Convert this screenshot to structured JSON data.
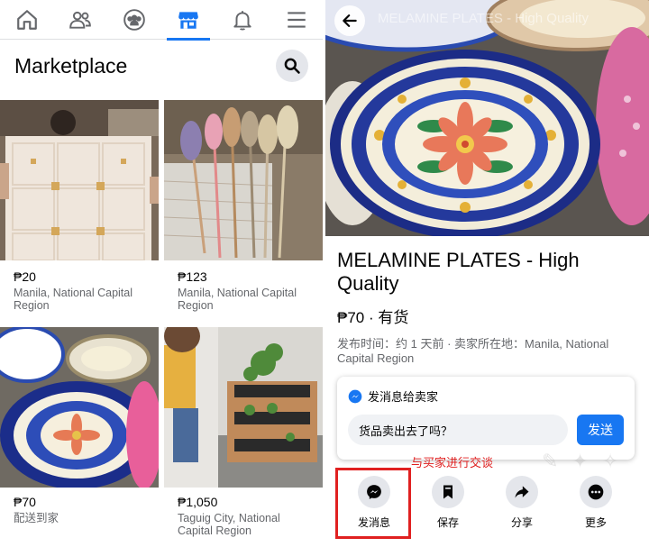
{
  "left": {
    "nav": [
      {
        "name": "home-icon"
      },
      {
        "name": "friends-icon"
      },
      {
        "name": "groups-icon"
      },
      {
        "name": "marketplace-icon",
        "active": true
      },
      {
        "name": "bell-icon"
      },
      {
        "name": "menu-icon"
      }
    ],
    "title": "Marketplace",
    "listings": [
      {
        "price": "₱20",
        "location": "Manila, National Capital Region"
      },
      {
        "price": "₱123",
        "location": "Manila, National Capital Region"
      },
      {
        "price": "₱70",
        "location": "配送到家"
      },
      {
        "price": "₱1,050",
        "location": "Taguig City, National Capital Region"
      }
    ]
  },
  "right": {
    "hero_title": "MELAMINE PLATES - High Quality",
    "title": "MELAMINE PLATES - High Quality",
    "price_status": "₱70 · 有货",
    "meta": "发布时间：约 1 天前 · 卖家所在地：Manila, National Capital Region",
    "message_card": {
      "header": "发消息给卖家",
      "input_value": "货品卖出去了吗？",
      "send_label": "发送"
    },
    "annotation": "与买家进行交谈",
    "actions": [
      {
        "label": "发消息",
        "icon": "messenger-icon"
      },
      {
        "label": "保存",
        "icon": "bookmark-icon"
      },
      {
        "label": "分享",
        "icon": "share-icon"
      },
      {
        "label": "更多",
        "icon": "more-icon"
      }
    ]
  },
  "colors": {
    "accent": "#1877f2",
    "highlight": "#e02020",
    "muted_text": "#65676b",
    "icon_bg": "#e4e6eb"
  }
}
